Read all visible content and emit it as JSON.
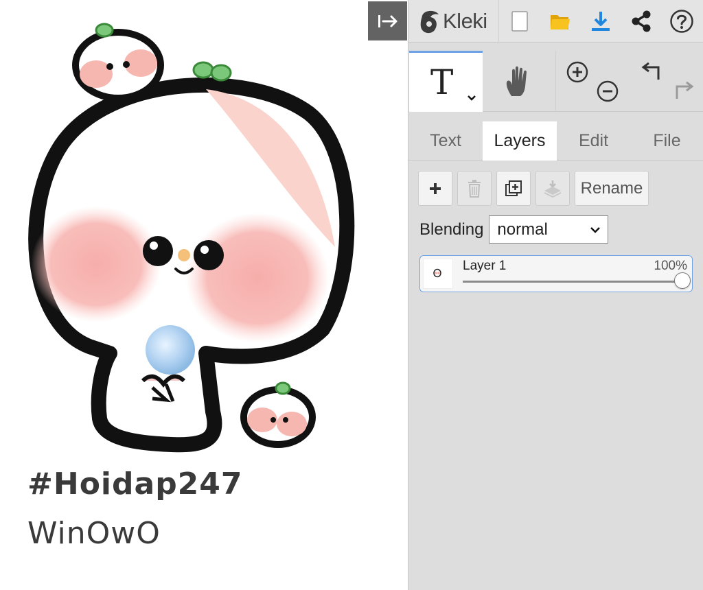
{
  "canvas": {
    "caption_line1": "#Hoidap247",
    "caption_line2": "WinOwO"
  },
  "collapse_button": {
    "icon": "collapse-panel-icon"
  },
  "toolbar": {
    "logo_text": "Kleki",
    "buttons": [
      {
        "name": "new-image",
        "icon": "new-file-icon"
      },
      {
        "name": "open-file",
        "icon": "folder-icon"
      },
      {
        "name": "save",
        "icon": "download-icon"
      },
      {
        "name": "share",
        "icon": "share-icon"
      },
      {
        "name": "help",
        "icon": "help-icon"
      }
    ],
    "colors": {
      "folder": "#f5b90f",
      "download": "#1f86e0"
    }
  },
  "tools": {
    "active_tool": "text",
    "text_tool_glyph": "T",
    "hand_tool": "hand-icon",
    "zoom": [
      "zoom-in-icon",
      "zoom-out-icon"
    ],
    "history": [
      "undo-icon",
      "redo-icon"
    ]
  },
  "tabs": [
    {
      "label": "Text",
      "active": false
    },
    {
      "label": "Layers",
      "active": true
    },
    {
      "label": "Edit",
      "active": false
    },
    {
      "label": "File",
      "active": false
    }
  ],
  "layers_panel": {
    "buttons": {
      "add": "plus-icon",
      "delete": "trash-icon",
      "duplicate": "duplicate-icon",
      "merge": "merge-down-icon",
      "rename_label": "Rename"
    },
    "blending_label": "Blending",
    "blending_value": "normal",
    "layers": [
      {
        "name": "Layer 1",
        "opacity_label": "100%",
        "opacity": 1.0
      }
    ]
  },
  "colors": {
    "panel_bg": "#dddddd",
    "accent": "#6ea2e4",
    "collapse_bg": "#636363"
  }
}
